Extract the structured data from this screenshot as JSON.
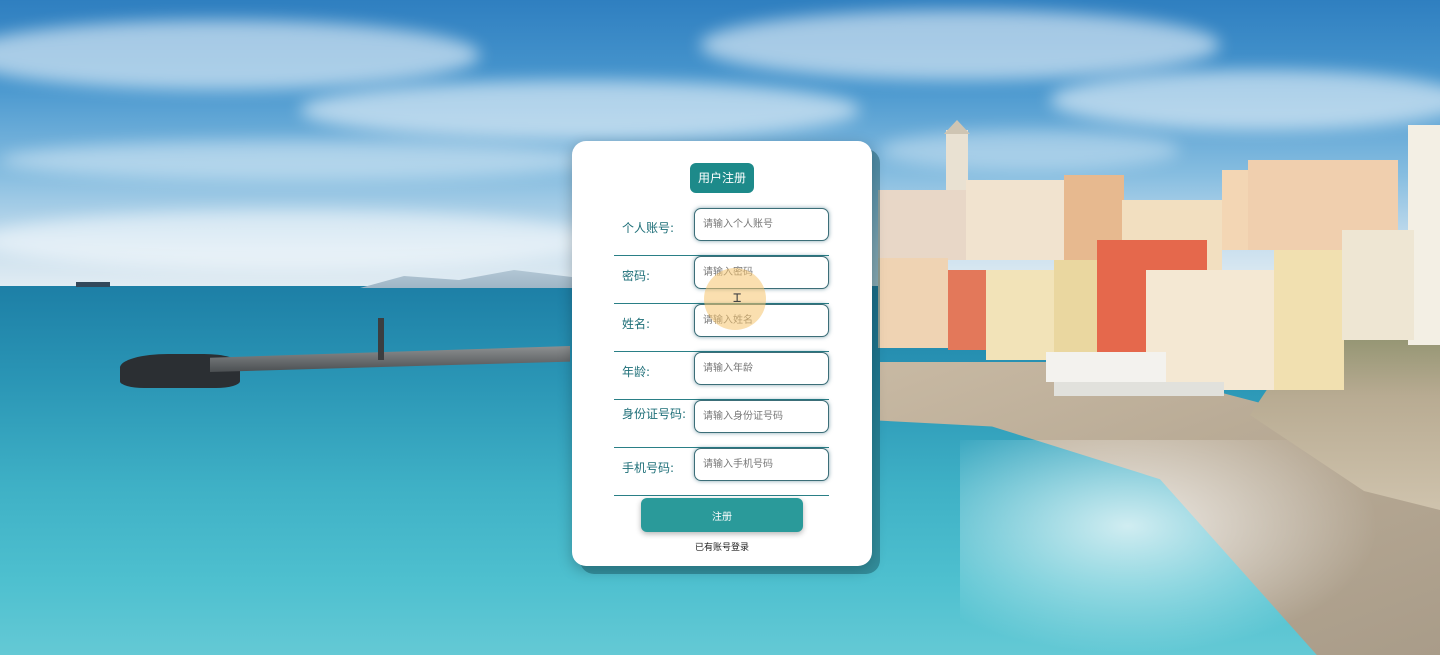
{
  "form": {
    "title": "用户注册",
    "fields": [
      {
        "label": "个人账号:",
        "placeholder": "请输入个人账号"
      },
      {
        "label": "密码:",
        "placeholder": "请输入密码"
      },
      {
        "label": "姓名:",
        "placeholder": "请输入姓名"
      },
      {
        "label": "年龄:",
        "placeholder": "请输入年龄"
      },
      {
        "label": "身份证号码:",
        "placeholder": "请输入身份证号码"
      },
      {
        "label": "手机号码:",
        "placeholder": "请输入手机号码"
      }
    ],
    "submit_label": "注册",
    "login_link": "已有账号登录"
  },
  "colors": {
    "accent": "#1d8a8a",
    "button": "#2a9a9a",
    "label": "#1e6f78"
  },
  "icons": {
    "cursor": "text-cursor-icon"
  }
}
